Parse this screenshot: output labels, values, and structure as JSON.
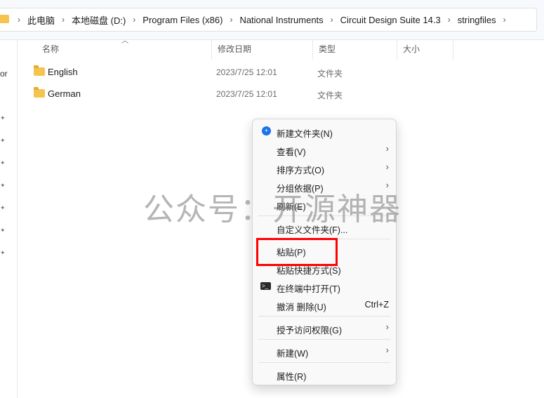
{
  "breadcrumb": {
    "items": [
      "此电脑",
      "本地磁盘 (D:)",
      "Program Files (x86)",
      "National Instruments",
      "Circuit Design Suite 14.3",
      "stringfiles"
    ]
  },
  "nav": {
    "partial_text": "or"
  },
  "columns": {
    "name": "名称",
    "date": "修改日期",
    "type": "类型",
    "size": "大小"
  },
  "files": [
    {
      "name": "English",
      "date": "2023/7/25 12:01",
      "type": "文件夹"
    },
    {
      "name": "German",
      "date": "2023/7/25 12:01",
      "type": "文件夹"
    }
  ],
  "context_menu": {
    "new_folder": "新建文件夹(N)",
    "view": "查看(V)",
    "sort_by": "排序方式(O)",
    "group_by": "分组依据(P)",
    "refresh": "刷新(E)",
    "customize_folder": "自定义文件夹(F)...",
    "paste": "粘贴(P)",
    "paste_shortcut": "粘贴快捷方式(S)",
    "open_in_terminal": "在终端中打开(T)",
    "undo_delete": "撤消 删除(U)",
    "undo_shortcut": "Ctrl+Z",
    "grant_access": "授予访问权限(G)",
    "new": "新建(W)",
    "properties": "属性(R)"
  },
  "watermark": "公众号：开源神器",
  "icons": {
    "folder": "folder-icon",
    "new_folder": "new-folder-icon",
    "terminal": "terminal-icon",
    "submenu": "chevron-right-icon"
  },
  "colors": {
    "highlight_box": "#ff0000",
    "folder": "#f4c44e"
  }
}
